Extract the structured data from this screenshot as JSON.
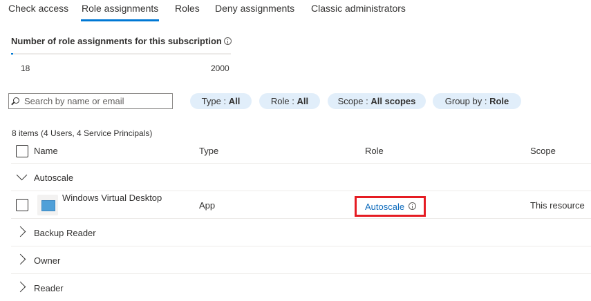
{
  "tabs": [
    {
      "label": "Check access"
    },
    {
      "label": "Role assignments"
    },
    {
      "label": "Roles"
    },
    {
      "label": "Deny assignments"
    },
    {
      "label": "Classic administrators"
    }
  ],
  "active_tab": "Role assignments",
  "role_assignment_count": {
    "title": "Number of role assignments for this subscription",
    "current": "18",
    "max": "2000",
    "progress_fraction": 0.009
  },
  "search": {
    "placeholder": "Search by name or email",
    "value": ""
  },
  "filters": {
    "type": {
      "label": "Type :",
      "value": "All"
    },
    "role": {
      "label": "Role :",
      "value": "All"
    },
    "scope": {
      "label": "Scope :",
      "value": "All scopes"
    },
    "group_by": {
      "label": "Group by :",
      "value": "Role"
    }
  },
  "items_summary": "8 items (4 Users, 4 Service Principals)",
  "table": {
    "headers": {
      "name": "Name",
      "type": "Type",
      "role": "Role",
      "scope": "Scope"
    },
    "groups": [
      {
        "label": "Autoscale",
        "expanded": true,
        "rows": [
          {
            "name": "Windows Virtual Desktop",
            "type": "App",
            "role": "Autoscale",
            "scope": "This resource"
          }
        ]
      },
      {
        "label": "Backup Reader",
        "expanded": false
      },
      {
        "label": "Owner",
        "expanded": false
      },
      {
        "label": "Reader",
        "expanded": false
      }
    ]
  },
  "colors": {
    "accent": "#0078d4",
    "link": "#0f6cbd",
    "pill_bg": "#e1eefa",
    "highlight": "#e51c23"
  },
  "icons": {
    "title_info": "info-icon",
    "search": "search-icon",
    "app": "app-icon",
    "role_info": "info-icon"
  }
}
